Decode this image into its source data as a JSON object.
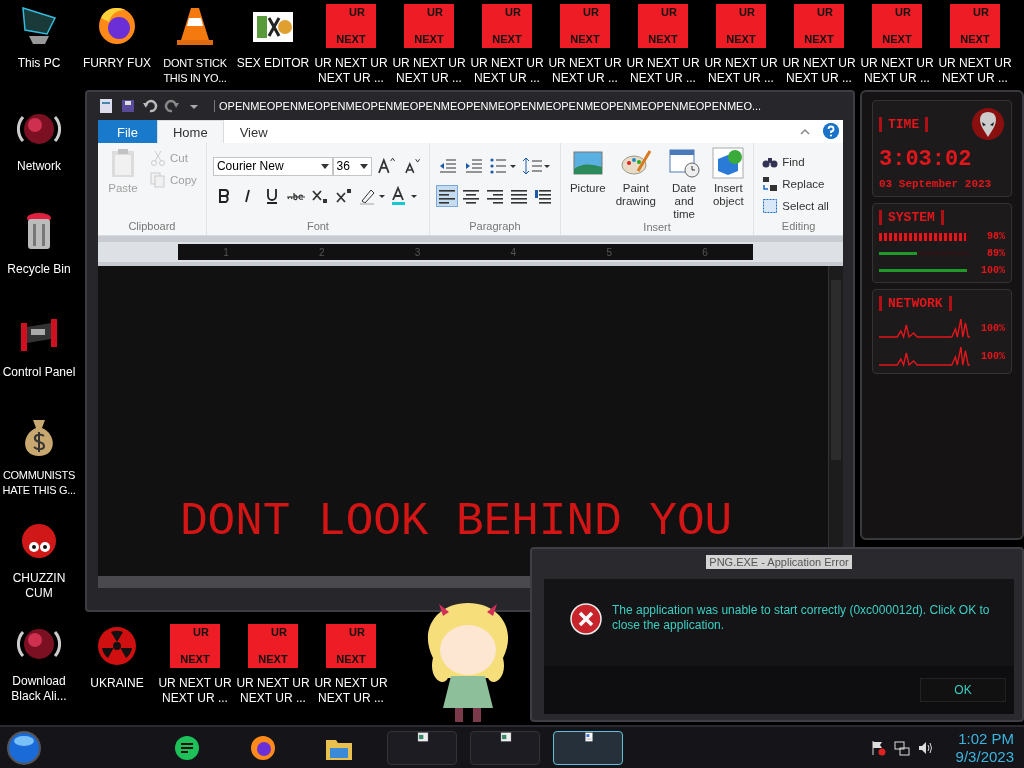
{
  "desktop_icons_left": [
    {
      "kind": "pc",
      "label": "This PC"
    },
    {
      "kind": "globe",
      "label": "Network"
    },
    {
      "kind": "bin",
      "label": "Recycle Bin"
    },
    {
      "kind": "panel",
      "label": "Control Panel"
    },
    {
      "kind": "money",
      "label": "COMMUNISTS HATE THIS G..."
    },
    {
      "kind": "fuzz",
      "label": "CHUZZIN CUM"
    },
    {
      "kind": "globe",
      "label": "Download Black Ali..."
    }
  ],
  "desktop_icons_top": [
    {
      "kind": "fox",
      "label": "FURRY FUX"
    },
    {
      "kind": "cone",
      "label": "DONT STICK THIS IN YO..."
    },
    {
      "kind": "tiles",
      "label": "SEX EDITOR"
    },
    {
      "kind": "ur",
      "label": "UR NEXT UR NEXT UR ...",
      "tile_top": "UR",
      "tile_bottom": "NEXT"
    },
    {
      "kind": "ur",
      "label": "UR NEXT UR NEXT UR ...",
      "tile_top": "UR",
      "tile_bottom": "NEXT"
    },
    {
      "kind": "ur",
      "label": "UR NEXT UR NEXT UR ...",
      "tile_top": "UR",
      "tile_bottom": "NEXT"
    },
    {
      "kind": "ur",
      "label": "UR NEXT UR NEXT UR ...",
      "tile_top": "UR",
      "tile_bottom": "NEXT"
    },
    {
      "kind": "ur",
      "label": "UR NEXT UR NEXT UR ...",
      "tile_top": "UR",
      "tile_bottom": "NEXT"
    },
    {
      "kind": "ur",
      "label": "UR NEXT UR NEXT UR ...",
      "tile_top": "UR",
      "tile_bottom": "NEXT"
    },
    {
      "kind": "ur",
      "label": "UR NEXT UR NEXT UR ...",
      "tile_top": "UR",
      "tile_bottom": "NEXT"
    },
    {
      "kind": "ur",
      "label": "UR NEXT UR NEXT UR ...",
      "tile_top": "UR",
      "tile_bottom": "NEXT"
    },
    {
      "kind": "ur",
      "label": "UR NEXT UR NEXT UR ...",
      "tile_top": "UR",
      "tile_bottom": "NEXT"
    }
  ],
  "desktop_icons_bottom": [
    {
      "kind": "radiation",
      "label": "UKRAINE"
    },
    {
      "kind": "ur",
      "label": "UR NEXT UR NEXT UR ...",
      "tile_top": "UR",
      "tile_bottom": "NEXT"
    },
    {
      "kind": "ur",
      "label": "UR NEXT UR NEXT UR ...",
      "tile_top": "UR",
      "tile_bottom": "NEXT"
    },
    {
      "kind": "ur",
      "label": "UR NEXT UR NEXT UR ...",
      "tile_top": "UR",
      "tile_bottom": "NEXT"
    }
  ],
  "wordpad": {
    "title": "OPENMEOPENMEOPENMEOPENMEOPENMEOPENMEOPENMEOPENMEOPENMEOPENMEOPENMEO...",
    "tabs": [
      {
        "kind": "file",
        "label": "File",
        "selected": false
      },
      {
        "kind": "tab",
        "label": "Home",
        "selected": true
      },
      {
        "kind": "tab",
        "label": "View",
        "selected": false
      }
    ],
    "clipboard": {
      "label": "Clipboard",
      "paste": {
        "label": "Paste",
        "disabled": true
      },
      "cut": {
        "label": "Cut",
        "disabled": true
      },
      "copy": {
        "label": "Copy",
        "disabled": true
      }
    },
    "font": {
      "label": "Font",
      "font_name": "Courier New",
      "font_size": "36"
    },
    "paragraph": {
      "label": "Paragraph",
      "alignments": [
        {
          "kind": "left",
          "selected": true
        },
        {
          "kind": "center",
          "selected": false
        },
        {
          "kind": "right",
          "selected": false
        },
        {
          "kind": "justify",
          "selected": false
        },
        {
          "kind": "rtl",
          "selected": false
        }
      ]
    },
    "insert": {
      "label": "Insert",
      "items": [
        {
          "kind": "picture",
          "label": "Picture"
        },
        {
          "kind": "paint",
          "label": "Paint drawing"
        },
        {
          "kind": "datetime",
          "label": "Date and time"
        },
        {
          "kind": "object",
          "label": "Insert object"
        }
      ]
    },
    "editing": {
      "label": "Editing",
      "items": [
        {
          "kind": "find",
          "label": "Find"
        },
        {
          "kind": "replace",
          "label": "Replace"
        },
        {
          "kind": "select",
          "label": "Select all"
        }
      ]
    },
    "ruler_numbers": [
      "1",
      "2",
      "3",
      "4",
      "5",
      "6"
    ],
    "document_text": "DONT LOOK BEHIND YOU"
  },
  "widget": {
    "time_heading": "TIME",
    "time": "3:03:02",
    "date": "03 September 2023",
    "system_heading": "SYSTEM",
    "system_meters": [
      {
        "kind": "chevrons",
        "level": 0.96,
        "reading": "98%"
      },
      {
        "kind": "bar",
        "level": 0.42,
        "reading": "89%"
      },
      {
        "kind": "bar",
        "level": 0.97,
        "reading": "100%"
      }
    ],
    "network_heading": "NETWORK",
    "network_readings": [
      "100%",
      "100%"
    ]
  },
  "error_dialog": {
    "title": "PNG.EXE - Application Error",
    "message": "The application was unable to start correctly (0xc000012d). Click OK to close the application.",
    "button": "OK"
  },
  "taskbar": {
    "apps": [
      {
        "kind": "chat",
        "selected": false
      },
      {
        "kind": "fox",
        "selected": false
      },
      {
        "kind": "folder",
        "selected": false
      },
      {
        "kind": "window",
        "selected": false
      },
      {
        "kind": "window",
        "selected": false
      },
      {
        "kind": "doc",
        "selected": true
      }
    ],
    "clock_time": "1:02 PM",
    "clock_date": "9/3/2023"
  }
}
